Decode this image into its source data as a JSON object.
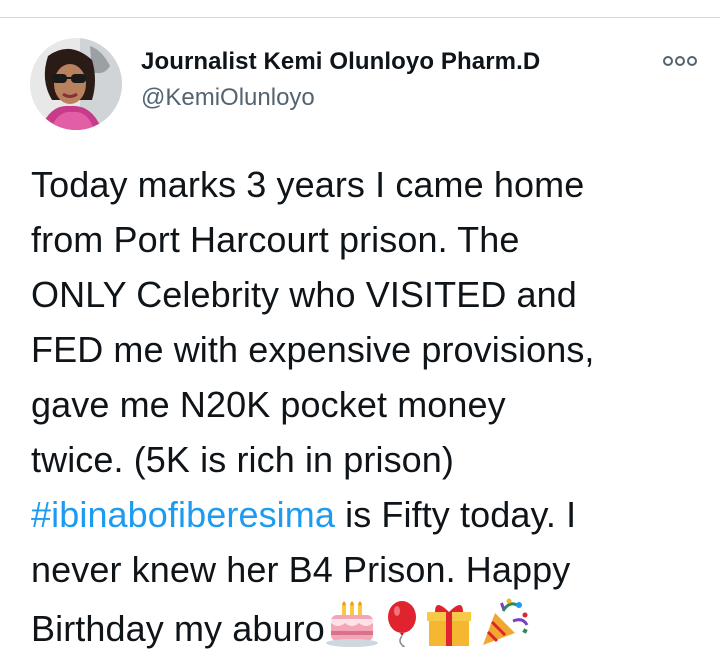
{
  "author": {
    "display_name": "Journalist Kemi Olunloyo Pharm.D",
    "handle": "@KemiOlunloyo"
  },
  "tweet": {
    "lines": [
      "Today marks 3 years I came home",
      "from Port Harcourt prison. The",
      "ONLY Celebrity who VISITED and",
      "FED me with expensive provisions,",
      "gave me N20K pocket money",
      "twice. (5K is rich in prison)"
    ],
    "hashtag": "#ibinabofiberesima",
    "after_hashtag": " is Fifty today. I",
    "line8": "never knew her B4 Prison. Happy",
    "line9": "Birthday my aburo",
    "emojis": [
      "birthday-cake",
      "balloon",
      "wrapped-gift",
      "party-popper"
    ]
  },
  "colors": {
    "hashtag": "#1d9bf0",
    "handle": "#536471",
    "text": "#0f1419"
  },
  "icons": {
    "more": "more-horizontal-icon"
  }
}
